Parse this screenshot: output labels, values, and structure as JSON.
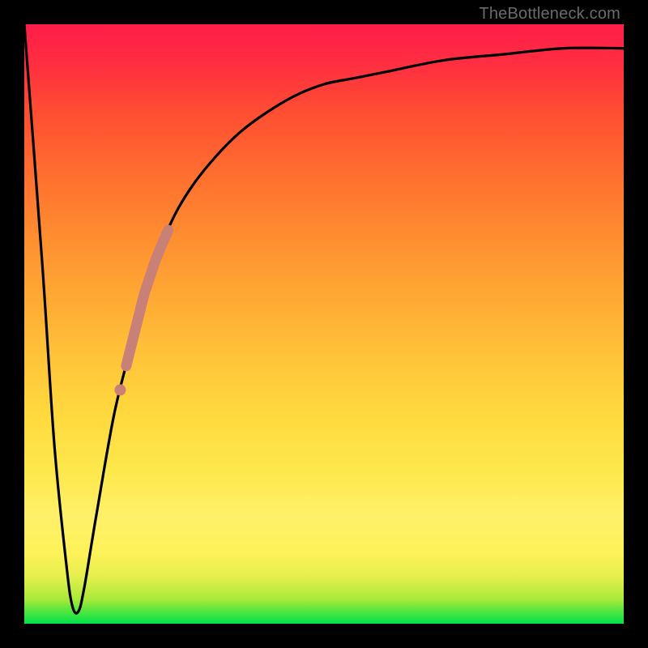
{
  "watermark": "TheBottleneck.com",
  "colors": {
    "frame": "#000000",
    "curve": "#000000",
    "highlight": "#c98077",
    "gradient_stops": [
      "#00e24c",
      "#4ee63f",
      "#a8e93a",
      "#e6ef4e",
      "#fef25a",
      "#fff069",
      "#fde94d",
      "#ffd93e",
      "#ffc239",
      "#ffa733",
      "#ff8c30",
      "#ff6e2f",
      "#ff4f32",
      "#ff2f40",
      "#ff1d4a"
    ]
  },
  "chart_data": {
    "type": "line",
    "title": "",
    "xlabel": "",
    "ylabel": "",
    "xlim": [
      0,
      100
    ],
    "ylim": [
      0,
      100
    ],
    "note": "V-shaped bottleneck curve; y-axis conceptually maps green→0 (good) to red→100 (bad). Values are read off the plotted black curve relative to the 740×740 plot area.",
    "series": [
      {
        "name": "bottleneck-curve",
        "x": [
          0,
          3,
          5,
          7,
          8,
          9,
          10,
          12,
          15,
          18,
          20,
          22,
          25,
          28,
          32,
          36,
          40,
          45,
          50,
          55,
          60,
          70,
          80,
          90,
          100
        ],
        "y": [
          100,
          60,
          30,
          10,
          3,
          2,
          6,
          18,
          35,
          47,
          55,
          61,
          68,
          73,
          78,
          82,
          85,
          88,
          90,
          91,
          92,
          94,
          95,
          96,
          96
        ]
      }
    ],
    "highlights": [
      {
        "name": "main-highlight",
        "x_range": [
          17,
          24
        ],
        "y_range": [
          44,
          65
        ],
        "style": "thick-pink-segment"
      },
      {
        "name": "dot-highlight",
        "x": 16,
        "y": 40,
        "style": "dot"
      }
    ]
  }
}
